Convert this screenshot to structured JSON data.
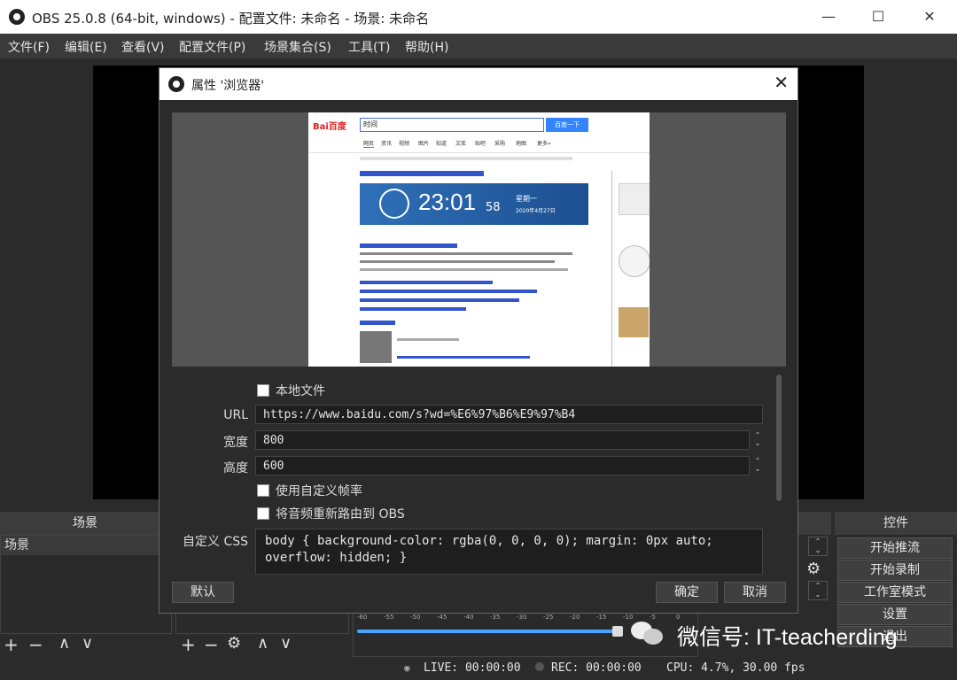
{
  "window": {
    "title": "OBS 25.0.8 (64-bit, windows) - 配置文件: 未命名 - 场景: 未命名",
    "minimize": "—",
    "maximize": "☐",
    "close": "✕"
  },
  "menu": [
    "文件(F)",
    "编辑(E)",
    "查看(V)",
    "配置文件(P)",
    "场景集合(S)",
    "工具(T)",
    "帮助(H)"
  ],
  "docks": {
    "scenes_title": "场景",
    "scene_item": "场景",
    "controls_title": "控件",
    "controls": [
      "开始推流",
      "开始录制",
      "工作室模式",
      "设置",
      "退出"
    ]
  },
  "statusbar": {
    "live": "LIVE: 00:00:00",
    "rec": "REC: 00:00:00",
    "cpu": "CPU: 4.7%, 30.00 fps"
  },
  "watermark": "微信号: IT-teacherding",
  "mixer_ticks": [
    "-60",
    "-55",
    "-50",
    "-45",
    "-40",
    "-35",
    "-30",
    "-25",
    "-20",
    "-15",
    "-10",
    "-5",
    "0"
  ],
  "dialog": {
    "title": "属性 '浏览器'",
    "close": "✕",
    "local_file_label": "本地文件",
    "url_label": "URL",
    "url_value": "https://www.baidu.com/s?wd=%E6%97%B6%E9%97%B4",
    "width_label": "宽度",
    "width_value": "800",
    "height_label": "高度",
    "height_value": "600",
    "custom_fps_label": "使用自定义帧率",
    "reroute_audio_label": "将音频重新路由到 OBS",
    "css_label": "自定义 CSS",
    "css_value": "body { background-color: rgba(0, 0, 0, 0); margin: 0px auto; overflow: hidden; }",
    "defaults_button": "默认",
    "ok_button": "确定",
    "cancel_button": "取消"
  },
  "baidu": {
    "logo": "Bai百度",
    "search_text": "时间",
    "search_button": "百度一下",
    "tabs": [
      "网页",
      "资讯",
      "视频",
      "图片",
      "知道",
      "文库",
      "贴吧",
      "采购",
      "地图",
      "更多»"
    ],
    "time_main": "23:01",
    "time_sec": "58",
    "weekday": "星期一",
    "date": "2020年4月27日"
  },
  "colors": {
    "accent_blue": "#3385ff",
    "obs_bg": "#2b2b2b",
    "volume_blue": "#4aa3ff"
  }
}
